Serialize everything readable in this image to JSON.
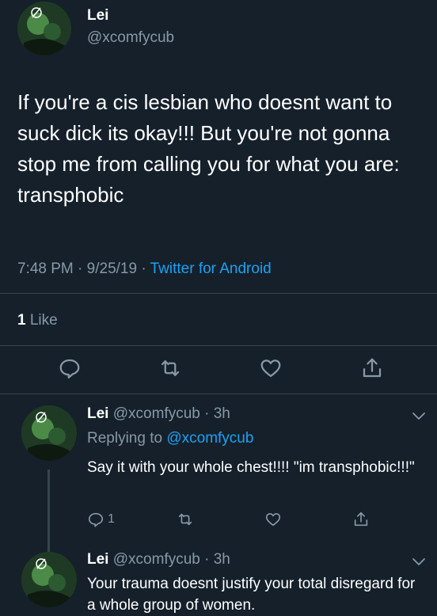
{
  "tweet": {
    "author_name": "Lei",
    "author_handle": "@xcomfycub",
    "text": "If you're a cis lesbian who doesnt want to suck dick its okay!!! But you're not gonna stop me from calling you for what you are: transphobic",
    "time": "7:48 PM",
    "date": "9/25/19",
    "source": "Twitter for Android",
    "like_count": "1",
    "like_label": "Like"
  },
  "replies": [
    {
      "author_name": "Lei",
      "author_handle": "@xcomfycub",
      "age": "3h",
      "replying_to_label": "Replying to",
      "replying_to_handle": "@xcomfycub",
      "text": "Say it with your whole chest!!!! \"im transphobic!!!\"",
      "reply_count": "1"
    },
    {
      "author_name": "Lei",
      "author_handle": "@xcomfycub",
      "age": "3h",
      "text": "Your trauma doesnt justify your total disregard for a whole group of women."
    }
  ],
  "icons": {
    "reply": "reply-icon",
    "retweet": "retweet-icon",
    "like": "heart-icon",
    "share": "share-icon",
    "more": "chevron-down-icon"
  },
  "colors": {
    "background": "#15202b",
    "secondary_text": "#8899a6",
    "accent": "#1da1f2",
    "divider": "#38444d"
  }
}
